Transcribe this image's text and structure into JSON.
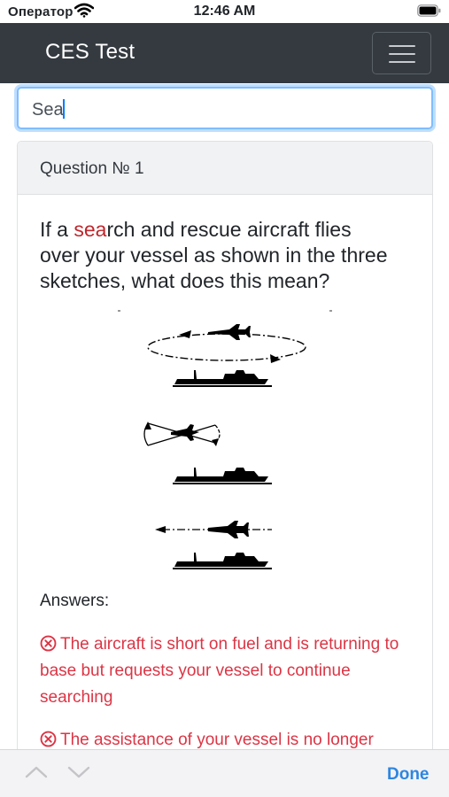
{
  "status_bar": {
    "carrier": "Оператор",
    "time": "12:46 AM"
  },
  "navbar": {
    "brand": "CES Test"
  },
  "search": {
    "value": "Sea"
  },
  "card": {
    "header": "Question № 1",
    "question": {
      "highlight": "sea",
      "rest_first": "rch and rescue aircraft flies",
      "prefix": "If a ",
      "line2": "over your vessel as shown in the three",
      "line3": "sketches, what does this mean?"
    },
    "answers_label": "Answers:",
    "answers": [
      {
        "lines": [
          "The aircraft is short on fuel and is returning to",
          "base but requests your vessel to continue",
          "searching"
        ],
        "status": "incorrect"
      },
      {
        "lines": [
          "The assistance of your vessel is no longer"
        ],
        "status": "incorrect"
      }
    ]
  },
  "toolbar": {
    "done_label": "Done"
  },
  "colors": {
    "navbar_bg": "#343a40",
    "highlight": "#c0262c",
    "incorrect_answer": "#dc3545",
    "done": "#2d86e0",
    "focus_border": "#80bdff"
  },
  "icons": {
    "status_wifi": "wifi-icon",
    "status_battery": "battery-icon",
    "nav_menu": "hamburger-menu-icon",
    "answer_incorrect": "circle-x-icon",
    "toolbar_prev": "chevron-up-icon",
    "toolbar_next": "chevron-down-icon"
  }
}
